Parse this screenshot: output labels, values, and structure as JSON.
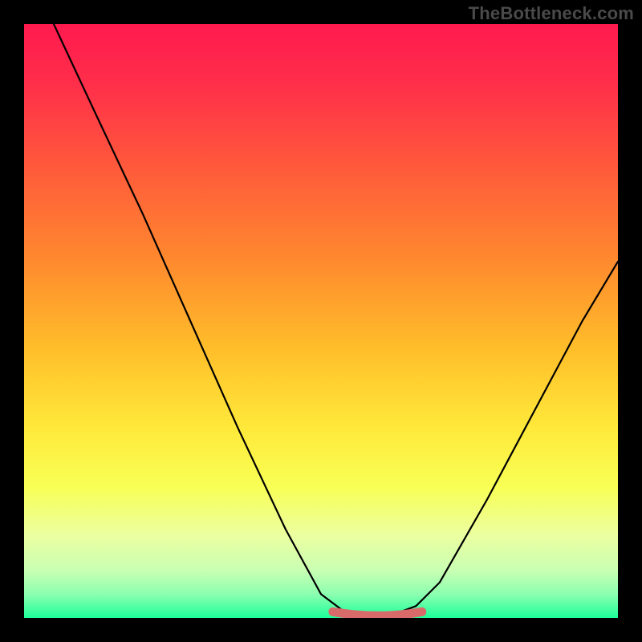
{
  "watermark": {
    "text": "TheBottleneck.com"
  },
  "colors": {
    "frame_bg": "#000000",
    "watermark": "#4a4a4a",
    "curve_stroke": "#000000",
    "well_stroke": "#d96a6a",
    "gradient_stops": [
      {
        "offset": "0%",
        "color": "#ff1a4e"
      },
      {
        "offset": "10%",
        "color": "#ff2e4a"
      },
      {
        "offset": "25%",
        "color": "#ff5c3a"
      },
      {
        "offset": "40%",
        "color": "#ff8a2e"
      },
      {
        "offset": "55%",
        "color": "#ffbf2a"
      },
      {
        "offset": "68%",
        "color": "#ffe93a"
      },
      {
        "offset": "78%",
        "color": "#f8ff55"
      },
      {
        "offset": "86%",
        "color": "#ecffa0"
      },
      {
        "offset": "92%",
        "color": "#c9ffb3"
      },
      {
        "offset": "96%",
        "color": "#8cffb0"
      },
      {
        "offset": "100%",
        "color": "#1dff9a"
      }
    ]
  },
  "chart_data": {
    "type": "line",
    "title": "",
    "xlabel": "",
    "ylabel": "",
    "xlim": [
      0,
      100
    ],
    "ylim": [
      0,
      100
    ],
    "series": [
      {
        "name": "bottleneck-curve",
        "points": [
          {
            "x": 5,
            "y": 100
          },
          {
            "x": 12,
            "y": 85
          },
          {
            "x": 20,
            "y": 68
          },
          {
            "x": 28,
            "y": 50
          },
          {
            "x": 36,
            "y": 32
          },
          {
            "x": 44,
            "y": 15
          },
          {
            "x": 50,
            "y": 4
          },
          {
            "x": 54,
            "y": 1
          },
          {
            "x": 58,
            "y": 0.5
          },
          {
            "x": 62,
            "y": 0.5
          },
          {
            "x": 66,
            "y": 2
          },
          {
            "x": 70,
            "y": 6
          },
          {
            "x": 78,
            "y": 20
          },
          {
            "x": 86,
            "y": 35
          },
          {
            "x": 94,
            "y": 50
          },
          {
            "x": 100,
            "y": 60
          }
        ]
      }
    ],
    "annotations": [
      {
        "name": "optimal-well-highlight",
        "x_range": [
          52,
          67
        ],
        "y": 0.5
      }
    ]
  }
}
